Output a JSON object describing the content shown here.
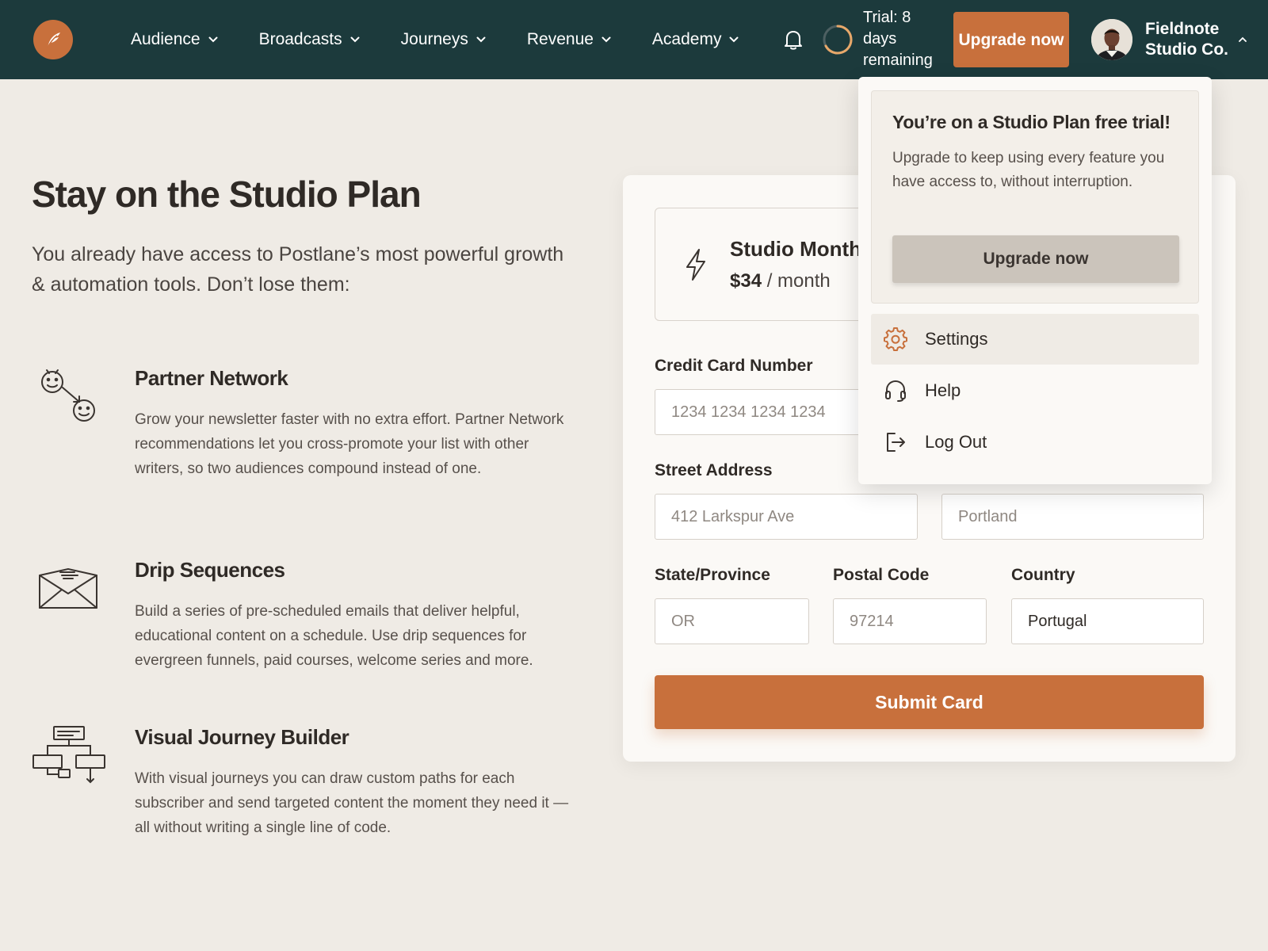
{
  "nav": {
    "items": [
      {
        "label": "Audience"
      },
      {
        "label": "Broadcasts"
      },
      {
        "label": "Journeys"
      },
      {
        "label": "Revenue"
      },
      {
        "label": "Academy"
      }
    ],
    "trial_text": "Trial: 8 days remaining",
    "upgrade_label": "Upgrade now",
    "account_name": "Fieldnote Studio Co."
  },
  "hero": {
    "title": "Stay on the Studio Plan",
    "intro": "You already have access to Postlane’s most powerful growth & automation tools. Don’t lose them:"
  },
  "features": [
    {
      "title": "Partner Network",
      "description": "Grow your newsletter faster with no extra effort. Partner Network recommendations let you cross-promote your list with other writers, so two audiences compound instead of one."
    },
    {
      "title": "Drip Sequences",
      "description": "Build a series of pre-scheduled emails that deliver helpful, educational content on a schedule. Use drip sequences for evergreen funnels, paid courses, welcome series and more."
    },
    {
      "title": "Visual Journey Builder",
      "description": "With visual journeys you can draw custom paths for each subscriber and send targeted content the moment they need it — all without writing a single line of code."
    }
  ],
  "plan": {
    "name": "Studio Monthly",
    "price": "$34",
    "period": " / month"
  },
  "form": {
    "card_number_label": "Credit Card Number",
    "card_number_placeholder": "1234 1234 1234 1234",
    "street_label": "Street Address",
    "street_placeholder": "412 Larkspur Ave",
    "city_placeholder": "Portland",
    "state_label": "State/Province",
    "state_placeholder": "OR",
    "postal_label": "Postal Code",
    "postal_placeholder": "97214",
    "country_label": "Country",
    "country_value": "Portugal",
    "submit_label": "Submit Card"
  },
  "dropdown": {
    "trial_title": "You’re on a Studio Plan free trial!",
    "trial_description": "Upgrade to keep using every feature you have access to, without interruption.",
    "upgrade_label": "Upgrade now",
    "menu": [
      {
        "label": "Settings",
        "icon": "gear-icon"
      },
      {
        "label": "Help",
        "icon": "headset-icon"
      },
      {
        "label": "Log Out",
        "icon": "logout-icon"
      }
    ]
  },
  "colors": {
    "nav_bg": "#1c3a3c",
    "accent": "#c8703c",
    "page_bg": "#efebe5"
  }
}
